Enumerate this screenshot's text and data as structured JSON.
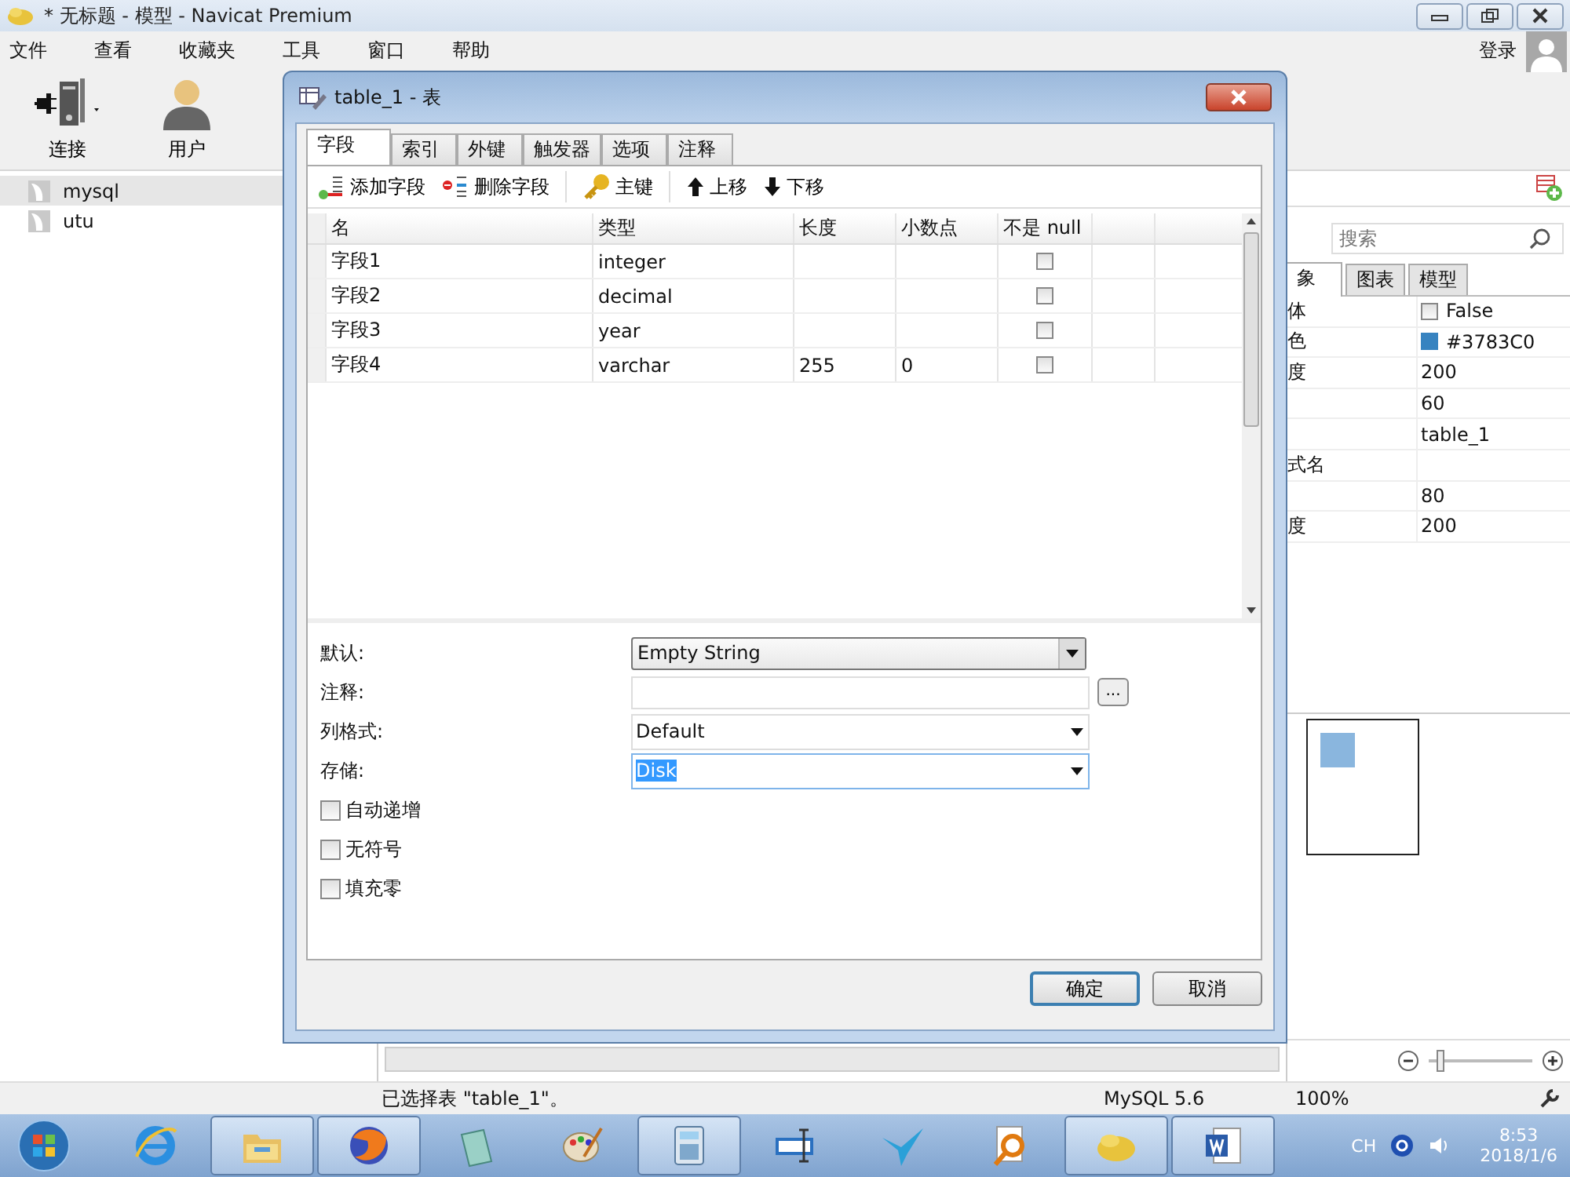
{
  "window": {
    "title": "* 无标题 - 模型 - Navicat Premium"
  },
  "menu": [
    "文件",
    "查看",
    "收藏夹",
    "工具",
    "窗口",
    "帮助"
  ],
  "toolbar": [
    {
      "label": "连接",
      "kind": "connect"
    },
    {
      "label": "用户",
      "kind": "user"
    }
  ],
  "login": "登录",
  "connections": [
    {
      "label": "mysql",
      "selected": true
    },
    {
      "label": "utu",
      "selected": false
    }
  ],
  "side_panel": {
    "search": {
      "placeholder": "搜索"
    },
    "tabs": [
      {
        "label": "象",
        "selected": true
      },
      {
        "label": "图表",
        "selected": false
      },
      {
        "label": "模型",
        "selected": false
      }
    ],
    "properties": [
      {
        "label": "体",
        "kind": "checkbox",
        "value": "False",
        "checked": false
      },
      {
        "label": "色",
        "kind": "color",
        "value": "#3783C0",
        "color": "#3783c0"
      },
      {
        "label": "度",
        "kind": "text",
        "value": "200"
      },
      {
        "kind": "text",
        "value": "60"
      },
      {
        "kind": "text",
        "value": "table_1"
      },
      {
        "label": "式名",
        "kind": "text"
      },
      {
        "kind": "text",
        "value": "80"
      },
      {
        "label": "度",
        "kind": "text",
        "value": "200"
      }
    ]
  },
  "dialog": {
    "title": "table_1 - 表",
    "tabs": [
      {
        "label": "字段",
        "selected": true
      },
      {
        "label": "索引",
        "selected": false
      },
      {
        "label": "外键",
        "selected": false
      },
      {
        "label": "触发器",
        "selected": false
      },
      {
        "label": "选项",
        "selected": false
      },
      {
        "label": "注释",
        "selected": false
      }
    ],
    "toolbar": [
      {
        "label": "添加字段",
        "kind": "add"
      },
      {
        "label": "删除字段",
        "kind": "delete"
      },
      {
        "label": "主键",
        "kind": "key"
      },
      {
        "label": "上移",
        "kind": "up"
      },
      {
        "label": "下移",
        "kind": "down"
      }
    ],
    "columns": [
      "名",
      "类型",
      "长度",
      "小数点",
      "不是 null"
    ],
    "rows": [
      {
        "name": "字段1",
        "type": "integer",
        "not_null": false
      },
      {
        "name": "字段2",
        "type": "decimal",
        "not_null": false
      },
      {
        "name": "字段3",
        "type": "year",
        "not_null": false
      },
      {
        "name": "字段4",
        "type": "varchar",
        "length": "255",
        "decimals": "0",
        "not_null": false
      }
    ],
    "field_props": [
      {
        "label": "默认:",
        "kind": "combo",
        "value": "Empty String"
      },
      {
        "label": "注释:",
        "kind": "text",
        "more": "..."
      },
      {
        "label": "列格式:",
        "kind": "select",
        "value": "Default",
        "focused": false
      },
      {
        "label": "存储:",
        "kind": "select",
        "value": "Disk",
        "focused": true
      }
    ],
    "options": [
      {
        "label": "自动递增",
        "checked": false
      },
      {
        "label": "无符号",
        "checked": false
      },
      {
        "label": "填充零",
        "checked": false
      }
    ],
    "buttons": [
      {
        "label": "确定",
        "default": true
      },
      {
        "label": "取消",
        "default": false
      }
    ]
  },
  "zoom_slider": {
    "level": 0.12
  },
  "status_bar": {
    "message": "已选择表 \"table_1\"。",
    "server": "MySQL 5.6",
    "zoom": "100%"
  },
  "taskbar": {
    "apps": [
      {
        "kind": "browser",
        "running": false
      },
      {
        "kind": "folder",
        "running": true
      },
      {
        "kind": "globe",
        "running": true
      },
      {
        "kind": "notepad",
        "running": false
      },
      {
        "kind": "palette",
        "running": false
      },
      {
        "kind": "calculator",
        "running": true
      },
      {
        "kind": "cursor",
        "running": false
      },
      {
        "kind": "bird",
        "running": false
      },
      {
        "kind": "magnifier",
        "running": false
      },
      {
        "kind": "blob",
        "running": true
      },
      {
        "kind": "document",
        "running": true
      }
    ],
    "language": "CH",
    "time": "8:53",
    "date": "2018/1/6"
  }
}
